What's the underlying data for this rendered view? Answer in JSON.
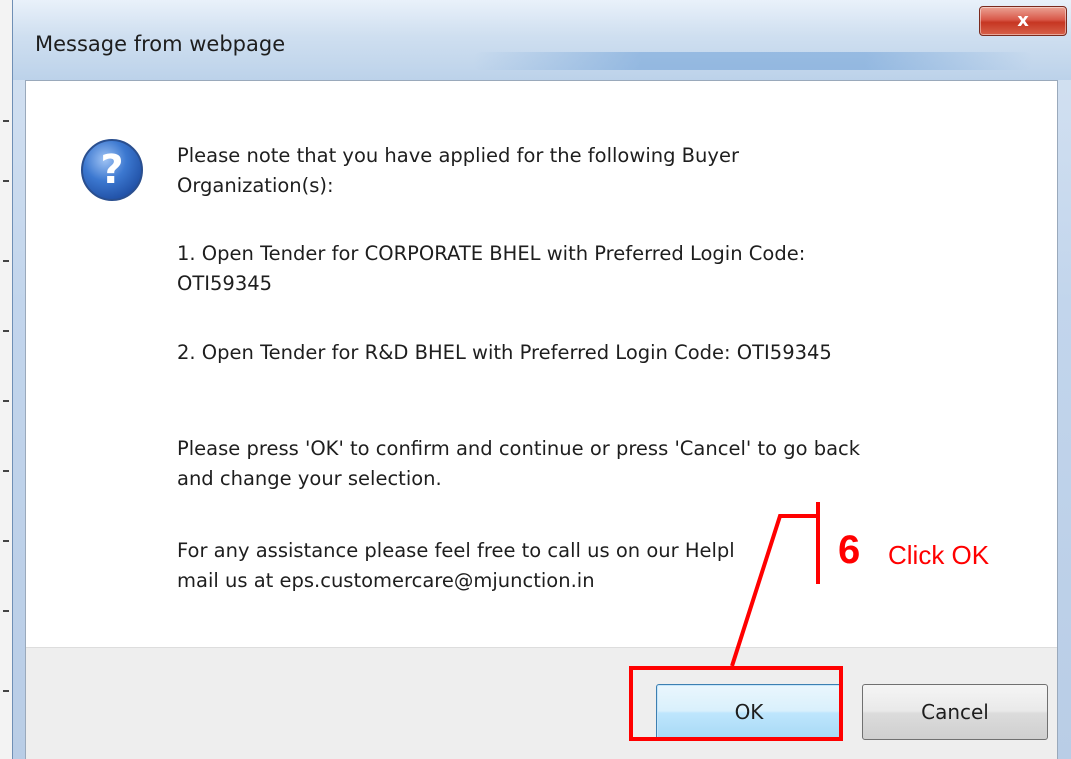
{
  "window": {
    "title": "Message from webpage",
    "close_label": "x"
  },
  "dialog": {
    "icon": "question-icon",
    "lines": [
      "Please note that you have applied for the following Buyer",
      "Organization(s):",
      "1. Open Tender for CORPORATE BHEL with Preferred Login Code:",
      "OTI59345",
      "2. Open Tender for R&D BHEL with Preferred Login Code: OTI59345",
      "Please press 'OK' to confirm and continue or press 'Cancel' to go back",
      "and change your selection.",
      "For any assistance please feel free to call us on our Helpl",
      "mail us at eps.customercare@mjunction.in"
    ],
    "ok_label": "OK",
    "cancel_label": "Cancel"
  },
  "annotation": {
    "step_number": "6",
    "step_text": "Click OK",
    "color": "#ff0000"
  }
}
